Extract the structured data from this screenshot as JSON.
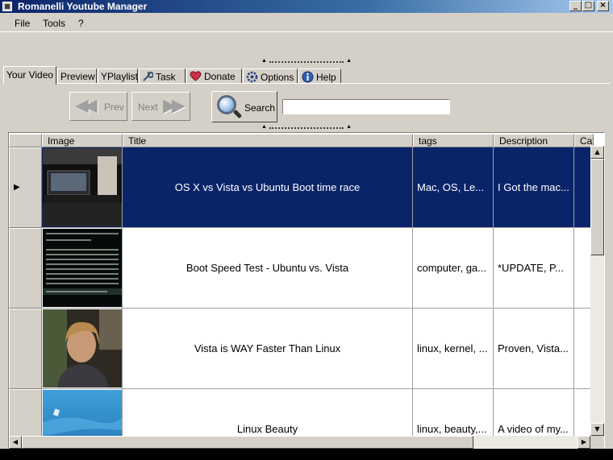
{
  "window": {
    "title": "Romanelli Youtube Manager"
  },
  "menu": {
    "items": [
      "File",
      "Tools",
      "?"
    ]
  },
  "tabs": [
    {
      "label": "Your Video",
      "icon": "",
      "active": true
    },
    {
      "label": "Preview",
      "icon": ""
    },
    {
      "label": "YPlaylist",
      "icon": ""
    },
    {
      "label": "Task",
      "icon": "wrench-icon"
    },
    {
      "label": "Donate",
      "icon": "heart-icon"
    },
    {
      "label": "Options",
      "icon": "gear-icon"
    },
    {
      "label": "Help",
      "icon": "info-icon"
    }
  ],
  "toolbar": {
    "prev_label": "Prev",
    "next_label": "Next",
    "search_label": "Search",
    "search_value": ""
  },
  "grid": {
    "columns": [
      "Image",
      "Title",
      "tags",
      "Description",
      "Cat"
    ],
    "rows": [
      {
        "title": "OS X vs Vista vs Ubuntu Boot time race",
        "tags": "Mac, OS, Le...",
        "description": "I Got the mac...",
        "selected": true
      },
      {
        "title": "Boot Speed Test - Ubuntu vs. Vista",
        "tags": "computer, ga...",
        "description": "*UPDATE, P...",
        "selected": false
      },
      {
        "title": "Vista is WAY Faster Than Linux",
        "tags": "linux, kernel, ...",
        "description": "Proven, Vista...",
        "selected": false
      },
      {
        "title": "Linux Beauty",
        "tags": "linux, beauty,...",
        "description": "A video of my...",
        "selected": false
      }
    ]
  },
  "colors": {
    "selection": "#0a246a",
    "face": "#d4d0c8"
  }
}
